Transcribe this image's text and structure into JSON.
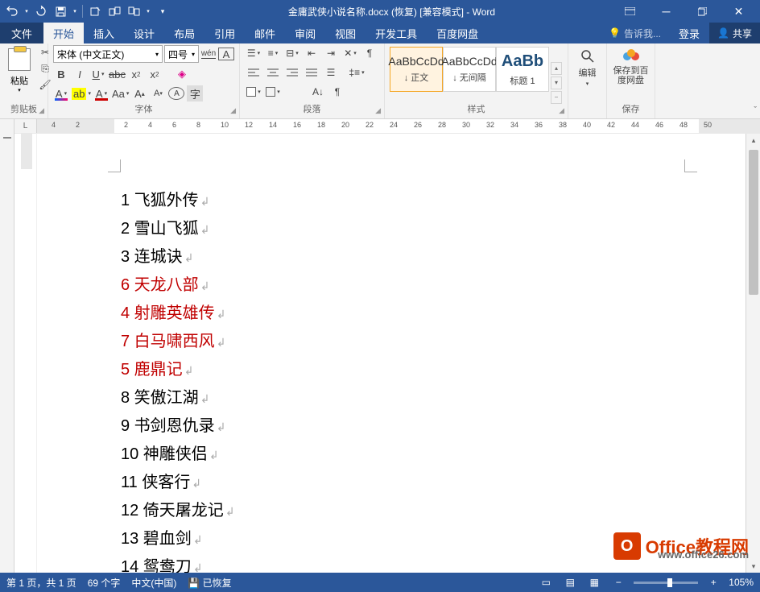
{
  "title": "金庸武侠小说名称.docx (恢复) [兼容模式] - Word",
  "qat": {
    "undo": "↶",
    "redo": "↻",
    "save": "💾"
  },
  "menu": {
    "file": "文件",
    "tabs": [
      "开始",
      "插入",
      "设计",
      "布局",
      "引用",
      "邮件",
      "审阅",
      "视图",
      "开发工具",
      "百度网盘"
    ],
    "active": 0,
    "tell_me": "告诉我...",
    "login": "登录",
    "share": "共享"
  },
  "ribbon": {
    "clipboard": {
      "label": "剪贴板",
      "paste": "粘贴"
    },
    "font": {
      "label": "字体",
      "name": "宋体 (中文正文)",
      "size": "四号"
    },
    "paragraph": {
      "label": "段落"
    },
    "styles": {
      "label": "样式",
      "items": [
        {
          "preview": "AaBbCcDd",
          "name": "↓ 正文",
          "selected": true
        },
        {
          "preview": "AaBbCcDd",
          "name": "↓ 无间隔",
          "selected": false
        },
        {
          "preview": "AaBb",
          "name": "标题 1",
          "selected": false
        }
      ]
    },
    "editing": {
      "label": "编辑"
    },
    "save_group": {
      "label": "保存",
      "btn": "保存到百度网盘"
    }
  },
  "ruler_ticks": [
    "4",
    "2",
    "",
    "2",
    "4",
    "6",
    "8",
    "10",
    "12",
    "14",
    "16",
    "18",
    "20",
    "22",
    "24",
    "26",
    "28",
    "30",
    "32",
    "34",
    "36",
    "38",
    "40",
    "42",
    "44",
    "46",
    "48",
    "50"
  ],
  "document": {
    "lines": [
      {
        "n": "1",
        "text": "飞狐外传",
        "red": false
      },
      {
        "n": "2",
        "text": "雪山飞狐",
        "red": false
      },
      {
        "n": "3",
        "text": "连城诀",
        "red": false
      },
      {
        "n": "6",
        "text": "天龙八部",
        "red": true
      },
      {
        "n": "4",
        "text": "射雕英雄传",
        "red": true
      },
      {
        "n": "7",
        "text": "白马啸西风",
        "red": true
      },
      {
        "n": "5",
        "text": "鹿鼎记",
        "red": true
      },
      {
        "n": "8",
        "text": "笑傲江湖",
        "red": false
      },
      {
        "n": "9",
        "text": "书剑恩仇录",
        "red": false
      },
      {
        "n": "10",
        "text": "神雕侠侣",
        "red": false
      },
      {
        "n": "11",
        "text": "侠客行",
        "red": false
      },
      {
        "n": "12",
        "text": "倚天屠龙记",
        "red": false
      },
      {
        "n": "13",
        "text": "碧血剑",
        "red": false
      },
      {
        "n": "14",
        "text": "鸳鸯刀",
        "red": false
      }
    ]
  },
  "status": {
    "page": "第 1 页，共 1 页",
    "words": "69 个字",
    "lang": "中文(中国)",
    "recovered": "已恢复",
    "zoom": "105%"
  },
  "watermark": {
    "brand": "Office教程网",
    "url": "www.office26.com"
  }
}
